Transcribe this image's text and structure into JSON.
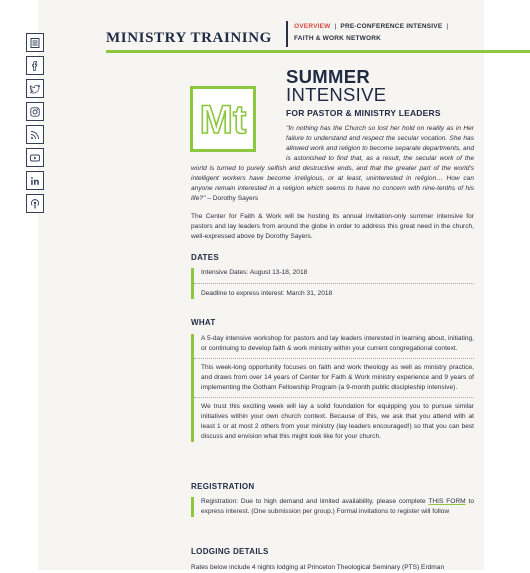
{
  "header": {
    "brand": "MINISTRY TRAINING",
    "nav": {
      "overview": "OVERVIEW",
      "pre_conference": "PRE-CONFERENCE INTENSIVE",
      "separator": "|",
      "network": "FAITH & WORK NETWORK"
    },
    "accent_color": "#8dc63f",
    "active_color": "#d34a3d"
  },
  "social_icons": [
    "newsletter-icon",
    "facebook-icon",
    "twitter-icon",
    "instagram-icon",
    "rss-icon",
    "youtube-icon",
    "linkedin-icon",
    "podcast-icon"
  ],
  "hero": {
    "logo_text": "Mt",
    "title_line1": "SUMMER",
    "title_line2": "INTENSIVE",
    "subtitle": "FOR PASTOR & MINISTRY LEADERS",
    "quote": "\"In nothing has the Church so lost her hold on reality as in Her failure to understand and respect the secular vocation. She has allowed work and religion to become separate departments, and is astonished to find that, as a result, the secular work of the world is turned to purely selfish and destructive ends, and that the greater part of the world's intelligent workers have become irreligious, or at least, uninterested in religion… How can anyone remain interested in a religion which seems to have no concern with nine-tenths of his life?\"",
    "quote_author": " – Dorothy Sayers",
    "intro": "The Center for Faith & Work will be hosting its annual invitation-only summer intensive for pastors and lay leaders from around the globe in order to address this great need in the church, well-expressed above by Dorothy Sayers."
  },
  "dates": {
    "heading": "DATES",
    "items": [
      "Intensive Dates: August 13-18, 2018",
      "Deadline to express interest: March 31, 2018"
    ]
  },
  "what": {
    "heading": "WHAT",
    "items": [
      "A 5-day intensive workshop for pastors and lay leaders interested in learning about, initiating, or continuing to develop faith & work ministry within your current congregational context.",
      "This week-long opportunity focuses on faith and work theology as well as ministry practice, and draws from over 14 years of Center for Faith & Work ministry experience and 9 years of implementing the Gotham Fellowship Program (a 9-month public discipleship intensive).",
      "We trust this exciting week will lay a solid foundation for equipping you to pursue similar initiatives within your own church context. Because of this, we ask that you attend with at least 1 or at most 2 others from your ministry (lay leaders encouraged!) so that you can best discuss and envision what this might look like for your church."
    ]
  },
  "registration": {
    "heading": "REGISTRATION",
    "text_before": "Registration: Due to high demand and limited availability, please complete ",
    "link_text": "THIS FORM",
    "text_after": " to express interest. (One submission per group.) Formal invitations to register will follow"
  },
  "lodging": {
    "heading": "LODGING DETAILS",
    "text": "Rates below include 4 nights lodging at Princeton Theological Seminary (PTS) Erdman"
  }
}
